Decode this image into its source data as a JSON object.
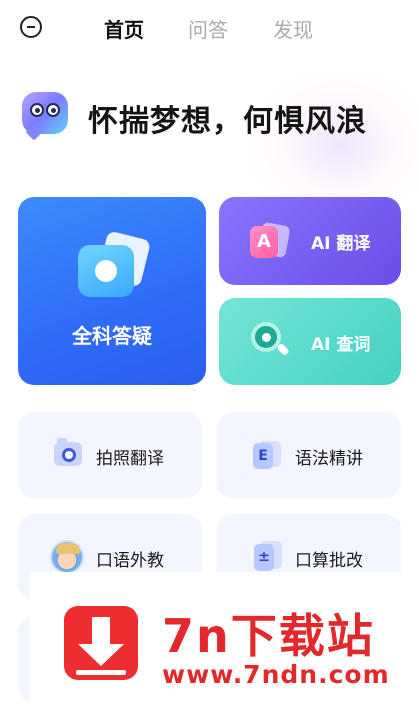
{
  "header": {
    "tabs": [
      {
        "label": "首页",
        "active": true
      },
      {
        "label": "问答",
        "active": false
      },
      {
        "label": "发现",
        "active": false
      }
    ]
  },
  "slogan": "怀揣梦想，何惧风浪",
  "cards": {
    "all_subject": "全科答疑",
    "translate": "AI 翻译",
    "translate_icon_letter": "A",
    "lookup": "AI 查词"
  },
  "tiles": {
    "photo_translate": "拍照翻译",
    "grammar": "语法精讲",
    "grammar_icon_letter": "E",
    "oral_tutor": "口语外教",
    "mental_math": "口算批改",
    "mental_math_icon_symbol": "±"
  },
  "watermark": {
    "title": "7n下载站",
    "url": "www.7ndn.com"
  },
  "colors": {
    "accent_blue": "#2f6cf6",
    "translate_purple": "#6b4de8",
    "lookup_teal": "#45d1c1",
    "tile_bg": "#f3f5ff",
    "watermark_red": "#e2282a"
  },
  "icons": {
    "menu": "circle-minus-icon",
    "mascot": "chat-bubble-mascot-icon",
    "all_subject": "camera-icon",
    "translate": "translate-icon",
    "lookup": "magnifier-icon",
    "photo_translate": "camera-icon",
    "grammar": "e-book-icon",
    "oral_tutor": "avatar-icon",
    "mental_math": "plus-minus-icon",
    "watermark": "download-arrow-icon"
  }
}
